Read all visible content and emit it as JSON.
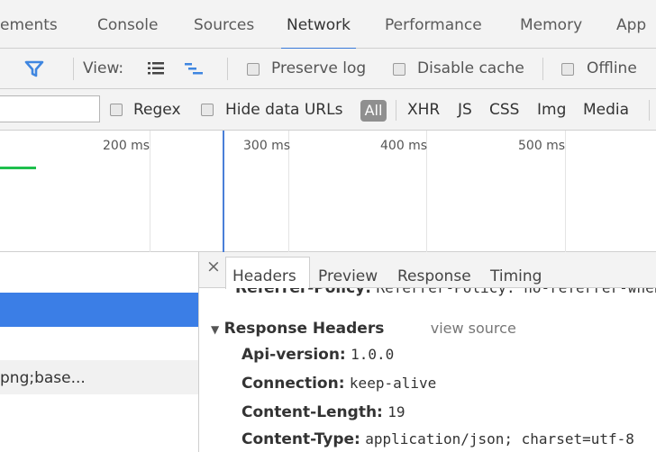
{
  "panel_tabs": [
    "ements",
    "Console",
    "Sources",
    "Network",
    "Performance",
    "Memory",
    "App"
  ],
  "toolbar": {
    "view_label": "View:",
    "preserve_log": "Preserve log",
    "disable_cache": "Disable cache",
    "offline": "Offline"
  },
  "filter": {
    "regex": "Regex",
    "hide_data_urls": "Hide data URLs",
    "all": "All",
    "types": [
      "XHR",
      "JS",
      "CSS",
      "Img",
      "Media"
    ]
  },
  "overview": {
    "ticks": [
      "200 ms",
      "300 ms",
      "400 ms",
      "500 ms"
    ]
  },
  "request_list": {
    "row2_text": "png;base..."
  },
  "details": {
    "close": "×",
    "tabs": [
      "Headers",
      "Preview",
      "Response",
      "Timing"
    ],
    "clipped_line": "Referrer-Policy: no-referrer-when-downgrade",
    "section_title": "Response Headers",
    "view_source": "view source",
    "headers": [
      {
        "name": "Api-version:",
        "value": "1.0.0"
      },
      {
        "name": "Connection:",
        "value": "keep-alive"
      },
      {
        "name": "Content-Length:",
        "value": "19"
      },
      {
        "name": "Content-Type:",
        "value": "application/json; charset=utf-8"
      }
    ]
  },
  "colors": {
    "accent": "#3879d9",
    "selection": "#3b7ee6",
    "filter_icon": "#3f86e0",
    "timeline_marker": "#4a7fd8",
    "overview_bar": "#1fbf4d"
  }
}
